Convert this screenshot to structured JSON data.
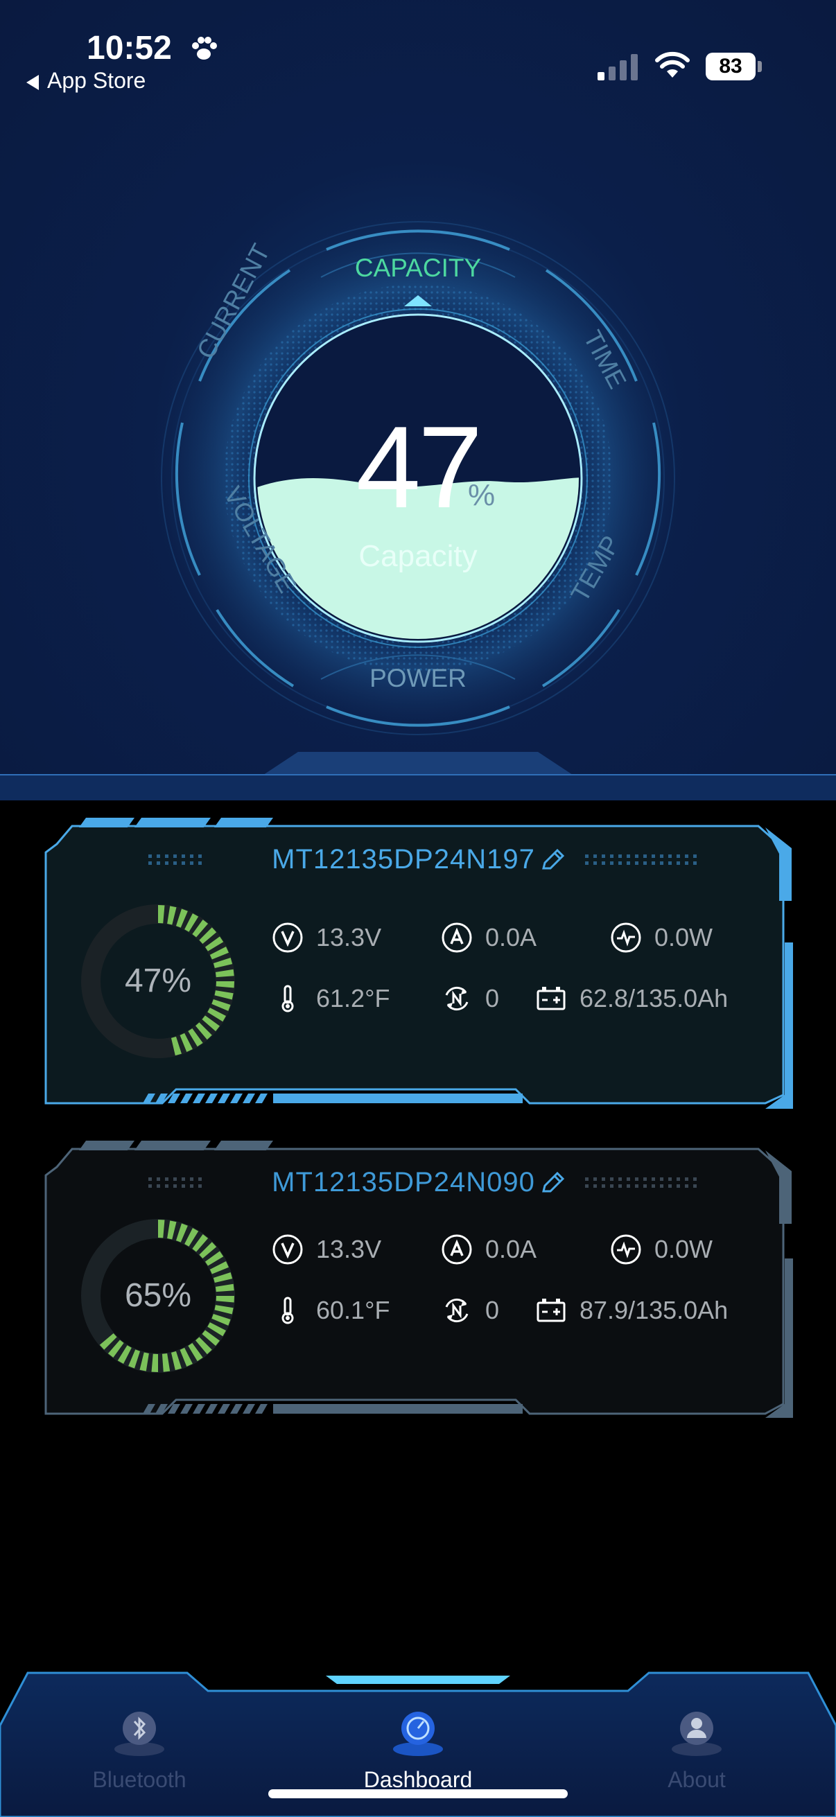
{
  "status_bar": {
    "time": "10:52",
    "back_label": "App Store",
    "battery": "83"
  },
  "gauge": {
    "value": "47",
    "unit": "%",
    "label": "Capacity",
    "level": 0.47,
    "sections": {
      "top": "CAPACITY",
      "bottom": "POWER",
      "upper_left": "CURRENT",
      "upper_right": "TIME",
      "lower_left": "VOLTAGE",
      "lower_right": "TEMP"
    }
  },
  "batteries": [
    {
      "name": "MT12135DP24N197",
      "percent": "47%",
      "level": 0.47,
      "voltage": "13.3V",
      "current": "0.0A",
      "power": "0.0W",
      "temperature": "61.2°F",
      "cycles": "0",
      "capacity": "62.8/135.0Ah"
    },
    {
      "name": "MT12135DP24N090",
      "percent": "65%",
      "level": 0.65,
      "voltage": "13.3V",
      "current": "0.0A",
      "power": "0.0W",
      "temperature": "60.1°F",
      "cycles": "0",
      "capacity": "87.9/135.0Ah"
    }
  ],
  "tabs": [
    {
      "label": "Bluetooth",
      "active": false
    },
    {
      "label": "Dashboard",
      "active": true
    },
    {
      "label": "About",
      "active": false
    }
  ],
  "colors": {
    "accent_blue": "#4aa9e8",
    "accent_green": "#7cc25a",
    "fill_mint": "#c8f7e6",
    "tab_active": "#ffffff",
    "tab_inactive": "#3a4b73"
  }
}
